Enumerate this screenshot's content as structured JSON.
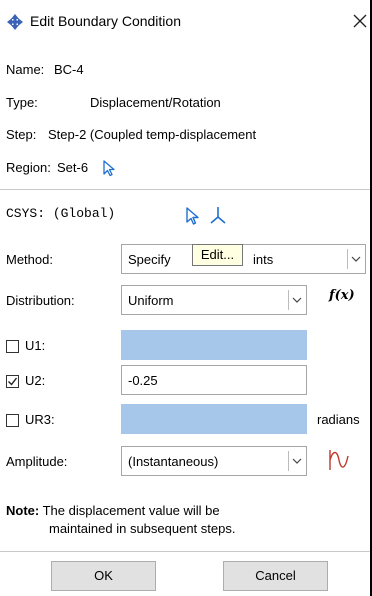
{
  "window": {
    "title": "Edit Boundary Condition",
    "close_glyph": "✕"
  },
  "info": {
    "name_label": "Name:",
    "name_value": "BC-4",
    "type_label": "Type:",
    "type_value": "Displacement/Rotation",
    "step_label": "Step:",
    "step_value": "Step-2 (Coupled temp-displacement",
    "region_label": "Region:",
    "region_value": "Set-6"
  },
  "csys": {
    "label": "CSYS:",
    "value": "(Global)"
  },
  "method": {
    "label": "Method:",
    "value_left": "Specify",
    "value_right": "ints"
  },
  "tooltip": {
    "text": "Edit..."
  },
  "distribution": {
    "label": "Distribution:",
    "value": "Uniform",
    "fx_label": "f(x)"
  },
  "dofs": [
    {
      "label": "U1:",
      "checked": false,
      "value": ""
    },
    {
      "label": "U2:",
      "checked": true,
      "value": "-0.25"
    },
    {
      "label": "UR3:",
      "checked": false,
      "value": "",
      "unit": "radians"
    }
  ],
  "amplitude": {
    "label": "Amplitude:",
    "value": "(Instantaneous)"
  },
  "note": {
    "label": "Note:",
    "line1": "The displacement value will be",
    "line2": "maintained in subsequent steps."
  },
  "buttons": {
    "ok": "OK",
    "cancel": "Cancel"
  },
  "colors": {
    "disabled_field": "#a6c7ea",
    "tooltip_bg": "#ffffe1",
    "icon_blue": "#1f6fd1",
    "amplitude_icon_red": "#c0392b"
  },
  "icons": {
    "title_icon": "arrows-cross-icon",
    "region_select": "cursor-arrow-icon",
    "csys_select": "cursor-arrow-icon",
    "csys_create": "axis-triad-icon",
    "amplitude_create": "amplitude-curve-icon"
  }
}
